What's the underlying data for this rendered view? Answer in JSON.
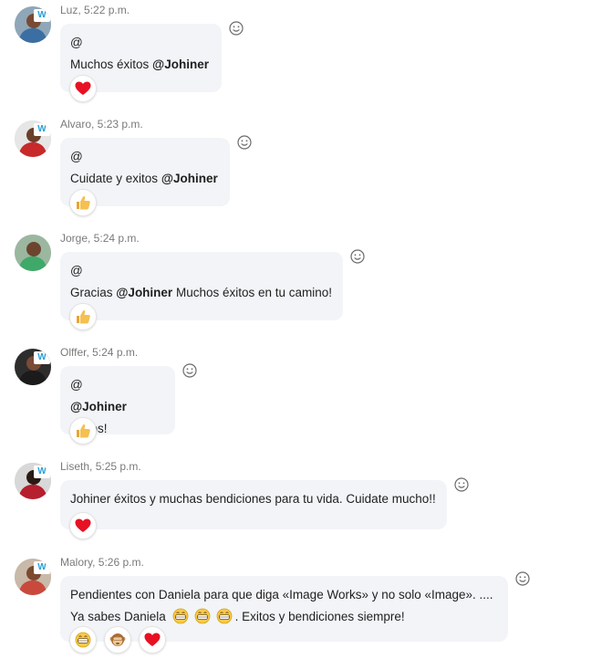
{
  "colors": {
    "bubble_bg": "#f2f4f7",
    "meta_text": "#7a7a7a",
    "heart": "#e81123",
    "thumb": "#f5b94a"
  },
  "messages": [
    {
      "meta": "Luz, 5:22 p.m.",
      "lines": [
        "@",
        "Muchos éxitos "
      ],
      "mention": "@Johiner",
      "reactions": [
        "heart"
      ]
    },
    {
      "meta": "Alvaro, 5:23 p.m.",
      "lines": [
        "@",
        "Cuidate y exitos "
      ],
      "mention": "@Johiner",
      "reactions": [
        "thumbs-up"
      ]
    },
    {
      "meta": "Jorge, 5:24 p.m.",
      "lines": [
        "@",
        "Gracias "
      ],
      "mention": "@Johiner",
      "after_mention": " Muchos éxitos en tu camino!",
      "reactions": [
        "thumbs-up"
      ]
    },
    {
      "meta": "Olffer, 5:24 p.m.",
      "lines": [
        "@",
        ""
      ],
      "mention": "@Johiner",
      "after_mention": " Exitos!",
      "reactions": [
        "thumbs-up"
      ]
    },
    {
      "meta": "Liseth, 5:25 p.m.",
      "text": "Johiner éxitos y muchas bendiciones para tu vida. Cuidate mucho!!",
      "reactions": [
        "heart"
      ]
    },
    {
      "meta": "Malory, 5:26 p.m.",
      "line1": "Pendientes con Daniela para que diga «Image Works» y no solo «Image». ....",
      "line2_start": "Ya sabes Daniela",
      "line2_end": ". Exitos y bendiciones siempre!",
      "inline_emoji": [
        "grin-emoji",
        "grin-emoji",
        "grin-emoji"
      ],
      "reactions": [
        "laugh",
        "monkey",
        "heart"
      ]
    }
  ]
}
